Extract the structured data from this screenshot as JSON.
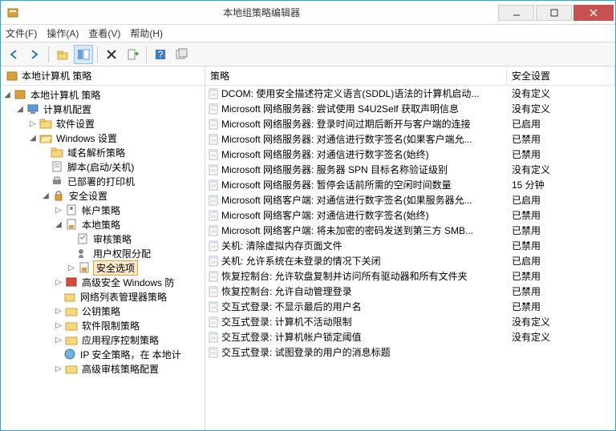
{
  "window": {
    "title": "本地组策略编辑器"
  },
  "menu": {
    "file": "文件(F)",
    "action": "操作(A)",
    "view": "查看(V)",
    "help": "帮助(H)"
  },
  "tree_header": "本地计算机 策略",
  "tree": {
    "root": "本地计算机 策略",
    "computer_config": "计算机配置",
    "software_settings": "软件设置",
    "windows_settings": "Windows 设置",
    "name_resolution": "域名解析策略",
    "scripts": "脚本(启动/关机)",
    "deployed_printers": "已部署的打印机",
    "security_settings": "安全设置",
    "account_policies": "帐户策略",
    "local_policies": "本地策略",
    "audit_policy": "审核策略",
    "user_rights": "用户权限分配",
    "security_options": "安全选项",
    "windows_defender_fw": "高级安全 Windows 防",
    "network_list": "网络列表管理器策略",
    "public_key": "公钥策略",
    "software_restriction": "软件限制策略",
    "app_control": "应用程序控制策略",
    "ip_security": "IP 安全策略，在 本地计",
    "advanced_audit": "高级审核策略配置"
  },
  "list_headers": {
    "policy": "策略",
    "setting": "安全设置"
  },
  "policies": [
    {
      "name": "DCOM: 使用安全描述符定义语言(SDDL)语法的计算机启动...",
      "setting": "没有定义"
    },
    {
      "name": "Microsoft 网络服务器: 尝试使用 S4U2Self 获取声明信息",
      "setting": "没有定义"
    },
    {
      "name": "Microsoft 网络服务器: 登录时间过期后断开与客户端的连接",
      "setting": "已启用"
    },
    {
      "name": "Microsoft 网络服务器: 对通信进行数字签名(如果客户端允...",
      "setting": "已禁用"
    },
    {
      "name": "Microsoft 网络服务器: 对通信进行数字签名(始终)",
      "setting": "已禁用"
    },
    {
      "name": "Microsoft 网络服务器: 服务器 SPN 目标名称验证级别",
      "setting": "没有定义"
    },
    {
      "name": "Microsoft 网络服务器: 暂停会话前所需的空闲时间数量",
      "setting": "15 分钟"
    },
    {
      "name": "Microsoft 网络客户端: 对通信进行数字签名(如果服务器允...",
      "setting": "已启用"
    },
    {
      "name": "Microsoft 网络客户端: 对通信进行数字签名(始终)",
      "setting": "已禁用"
    },
    {
      "name": "Microsoft 网络客户端: 将未加密的密码发送到第三方 SMB...",
      "setting": "已禁用"
    },
    {
      "name": "关机: 清除虚拟内存页面文件",
      "setting": "已禁用"
    },
    {
      "name": "关机: 允许系统在未登录的情况下关闭",
      "setting": "已启用"
    },
    {
      "name": "恢复控制台: 允许软盘复制并访问所有驱动器和所有文件夹",
      "setting": "已禁用"
    },
    {
      "name": "恢复控制台: 允许自动管理登录",
      "setting": "已禁用"
    },
    {
      "name": "交互式登录: 不显示最后的用户名",
      "setting": "已禁用"
    },
    {
      "name": "交互式登录: 计算机不活动限制",
      "setting": "没有定义"
    },
    {
      "name": "交互式登录: 计算机帐户锁定阈值",
      "setting": "没有定义"
    },
    {
      "name": "交互式登录: 试图登录的用户的消息标题",
      "setting": ""
    }
  ]
}
